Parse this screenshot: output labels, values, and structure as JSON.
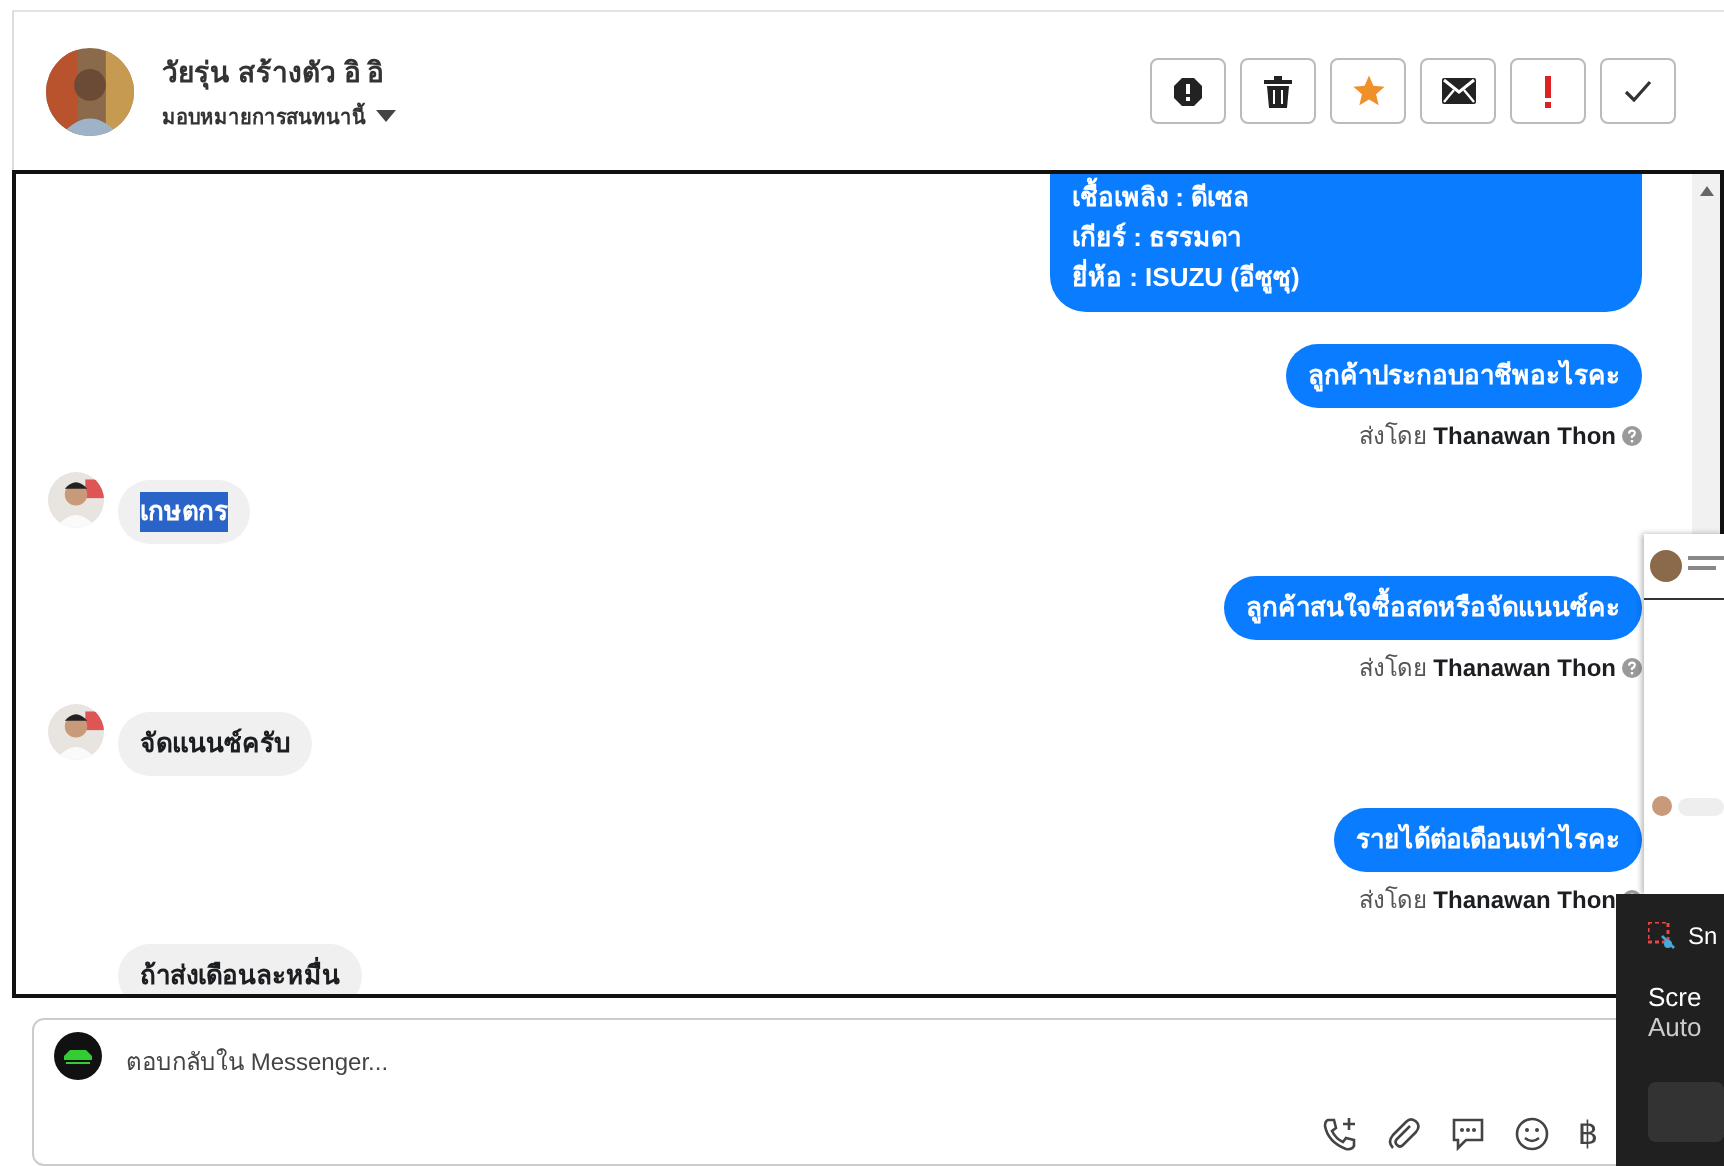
{
  "header": {
    "name": "วัยรุ่น สร้างตัว อิ อิ",
    "assign": "มอบหมายการสนทนานี้"
  },
  "actions": [
    {
      "kind": "report"
    },
    {
      "kind": "trash"
    },
    {
      "kind": "star"
    },
    {
      "kind": "mail"
    },
    {
      "kind": "alert"
    },
    {
      "kind": "check"
    }
  ],
  "messages": [
    {
      "kind": "out",
      "lines": [
        "เชื้อเพลิง : ดีเซล",
        "เกียร์ : ธรรมดา",
        "ยี่ห้อ : ISUZU (อีซูซุ)"
      ],
      "cut_top": true
    },
    {
      "kind": "out",
      "lines": [
        "ลูกค้าประกอบอาชีพอะไรคะ"
      ],
      "sender_label": "ส่งโดย",
      "sender": "Thanawan Thon"
    },
    {
      "kind": "in",
      "lines": [
        "เกษตกร"
      ],
      "highlighted": true
    },
    {
      "kind": "out",
      "lines": [
        "ลูกค้าสนใจซื้อสดหรือจัดแนนซ์คะ"
      ],
      "sender_label": "ส่งโดย",
      "sender": "Thanawan Thon"
    },
    {
      "kind": "in",
      "lines": [
        "จัดแนนซ์ครับ"
      ],
      "highlighted": false
    },
    {
      "kind": "out",
      "lines": [
        "รายได้ต่อเดือนเท่าไรคะ"
      ],
      "sender_label": "ส่งโดย",
      "sender": "Thanawan Thon"
    },
    {
      "kind": "in",
      "lines": [
        "ถ้าส่งเดือนละหมื่น"
      ],
      "highlighted": false,
      "no_avatar": true
    }
  ],
  "reply": {
    "placeholder": "ตอบกลับใน Messenger..."
  },
  "tools": [
    {
      "kind": "call"
    },
    {
      "kind": "clip"
    },
    {
      "kind": "chat"
    },
    {
      "kind": "smile"
    },
    {
      "kind": "baht",
      "glyph": "฿"
    }
  ],
  "notification": {
    "app": "Sn",
    "line1": "Scre",
    "line2": "Auto"
  }
}
